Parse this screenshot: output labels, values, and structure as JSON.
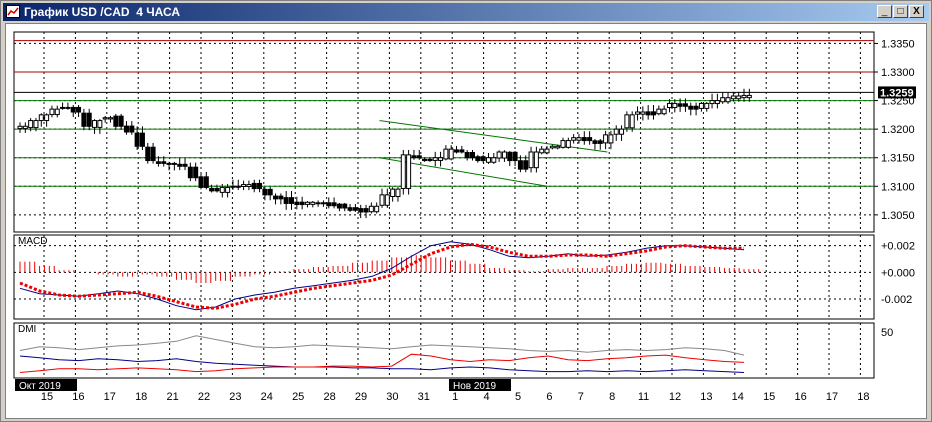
{
  "window": {
    "title": "График USD /CAD  4 ЧАСА",
    "buttons": [
      "_",
      "□",
      "X"
    ]
  },
  "colors": {
    "titlebar": "#0a246a",
    "support_line": "#007700",
    "resistance_line": "#aa0000",
    "price_label_bg": "#000000",
    "macd_signal": "#ee0000",
    "dmi_adx": "#888888",
    "dmi_plus": "#ee0000",
    "dmi_minus": "#000088"
  },
  "chart_data": [
    {
      "type": "candlestick",
      "panel": "price",
      "ylim": [
        1.302,
        1.337
      ],
      "y_ticks": [
        "1.3350",
        "1.3300",
        "1.3250",
        "1.3200",
        "1.3150",
        "1.3100",
        "1.3050"
      ],
      "current_price": "1.3259",
      "horizontal_lines": [
        {
          "value": 1.3355,
          "color": "red"
        },
        {
          "value": 1.33,
          "color": "red"
        },
        {
          "value": 1.325,
          "color": "green"
        },
        {
          "value": 1.32,
          "color": "green"
        },
        {
          "value": 1.315,
          "color": "green"
        },
        {
          "value": 1.31,
          "color": "green"
        }
      ],
      "trend_channel": {
        "upper": [
          [
            0.425,
            1.3215
          ],
          [
            0.69,
            1.316
          ]
        ],
        "lower": [
          [
            0.425,
            1.315
          ],
          [
            0.62,
            1.31
          ]
        ],
        "color": "green"
      },
      "close_path": [
        1.3205,
        1.3215,
        1.3225,
        1.3235,
        1.3238,
        1.323,
        1.3205,
        1.3215,
        1.322,
        1.3205,
        1.3195,
        1.317,
        1.3145,
        1.314,
        1.314,
        1.3135,
        1.3115,
        1.3098,
        1.3092,
        1.3098,
        1.31,
        1.3103,
        1.3096,
        1.3085,
        1.3078,
        1.307,
        1.3068,
        1.3072,
        1.307,
        1.3066,
        1.3062,
        1.3058,
        1.3055,
        1.3065,
        1.3085,
        1.3095,
        1.3155,
        1.315,
        1.3145,
        1.315,
        1.3165,
        1.316,
        1.315,
        1.3145,
        1.315,
        1.316,
        1.3145,
        1.313,
        1.316,
        1.3165,
        1.317,
        1.318,
        1.3185,
        1.318,
        1.3175,
        1.319,
        1.32,
        1.3225,
        1.323,
        1.3225,
        1.3235,
        1.3245,
        1.324,
        1.3235,
        1.3245,
        1.325,
        1.3255,
        1.3258,
        1.3259
      ]
    },
    {
      "type": "line",
      "panel": "MACD",
      "title": "MACD",
      "ylim": [
        -0.0035,
        0.0028
      ],
      "y_ticks": [
        "+0.002",
        "+0.000",
        "-0.002"
      ],
      "series": [
        {
          "values": [
            -0.0012,
            -0.0016,
            -0.0017,
            -0.0018,
            -0.0016,
            -0.0014,
            -0.0016,
            -0.002,
            -0.0025,
            -0.0028,
            -0.0026,
            -0.002,
            -0.0017,
            -0.0015,
            -0.0012,
            -0.001,
            -0.0008,
            -0.0006,
            -0.0003,
            0.0003,
            0.0012,
            0.002,
            0.0023,
            0.0021,
            0.0017,
            0.0012,
            0.0011,
            0.0012,
            0.0014,
            0.0012,
            0.0013,
            0.0015,
            0.0018,
            0.002,
            0.002,
            0.0019,
            0.0018,
            0.0017
          ]
        },
        {
          "values": [
            -0.0008,
            -0.0014,
            -0.0017,
            -0.0018,
            -0.0017,
            -0.0016,
            -0.0015,
            -0.0018,
            -0.0022,
            -0.0026,
            -0.0027,
            -0.0024,
            -0.002,
            -0.0018,
            -0.0015,
            -0.0012,
            -0.001,
            -0.0008,
            -0.0006,
            -0.0002,
            0.0006,
            0.0014,
            0.0019,
            0.0021,
            0.0019,
            0.0015,
            0.0012,
            0.0012,
            0.0013,
            0.0013,
            0.0012,
            0.0014,
            0.0016,
            0.0019,
            0.002,
            0.0019,
            0.0018,
            0.0018
          ]
        }
      ],
      "histogram": [
        0.001,
        0.0006,
        0.0002,
        0.0,
        -0.0002,
        -0.0004,
        -0.0002,
        -0.0004,
        -0.0007,
        -0.001,
        -0.0008,
        -0.0004,
        -0.0002,
        0.0001,
        0.0003,
        0.0005,
        0.0006,
        0.0009,
        0.0011,
        0.0014,
        0.0016,
        0.0014,
        0.0011,
        0.0008,
        0.0004,
        0.0002,
        0.0001,
        0.0003,
        0.0004,
        0.0004,
        0.0006,
        0.0008,
        0.0009,
        0.0008,
        0.0006,
        0.0005,
        0.0004,
        0.0003
      ]
    },
    {
      "type": "line",
      "panel": "DMI",
      "title": "DMI",
      "ylim": [
        0,
        60
      ],
      "y_ticks": [
        "50"
      ],
      "series": [
        {
          "values": [
            30,
            34,
            33,
            31,
            33,
            35,
            36,
            38,
            40,
            46,
            42,
            38,
            34,
            33,
            34,
            36,
            35,
            34,
            33,
            32,
            34,
            36,
            35,
            34,
            33,
            32,
            30,
            29,
            30,
            28,
            30,
            31,
            30,
            31,
            33,
            32,
            30,
            25
          ]
        },
        {
          "values": [
            24,
            22,
            20,
            19,
            21,
            20,
            18,
            19,
            21,
            18,
            16,
            15,
            14,
            13,
            12,
            12,
            12,
            11,
            11,
            10,
            10,
            9,
            11,
            12,
            11,
            9,
            8,
            7,
            7,
            8,
            7,
            8,
            7,
            8,
            9,
            8,
            7,
            6
          ]
        },
        {
          "values": [
            6,
            8,
            10,
            10,
            9,
            10,
            11,
            10,
            9,
            7,
            8,
            10,
            11,
            12,
            12,
            12,
            13,
            13,
            12,
            13,
            26,
            24,
            20,
            18,
            20,
            19,
            22,
            24,
            20,
            19,
            21,
            22,
            24,
            25,
            22,
            20,
            18,
            17
          ]
        }
      ]
    }
  ],
  "x_axis": {
    "labels": [
      "15",
      "16",
      "17",
      "18",
      "21",
      "22",
      "23",
      "24",
      "25",
      "28",
      "29",
      "30",
      "31",
      "1",
      "4",
      "5",
      "6",
      "7",
      "8",
      "11",
      "12",
      "13",
      "14",
      "15",
      "16",
      "17",
      "18"
    ],
    "period_labels": [
      "Окт 2019",
      "Нов 2019"
    ]
  }
}
